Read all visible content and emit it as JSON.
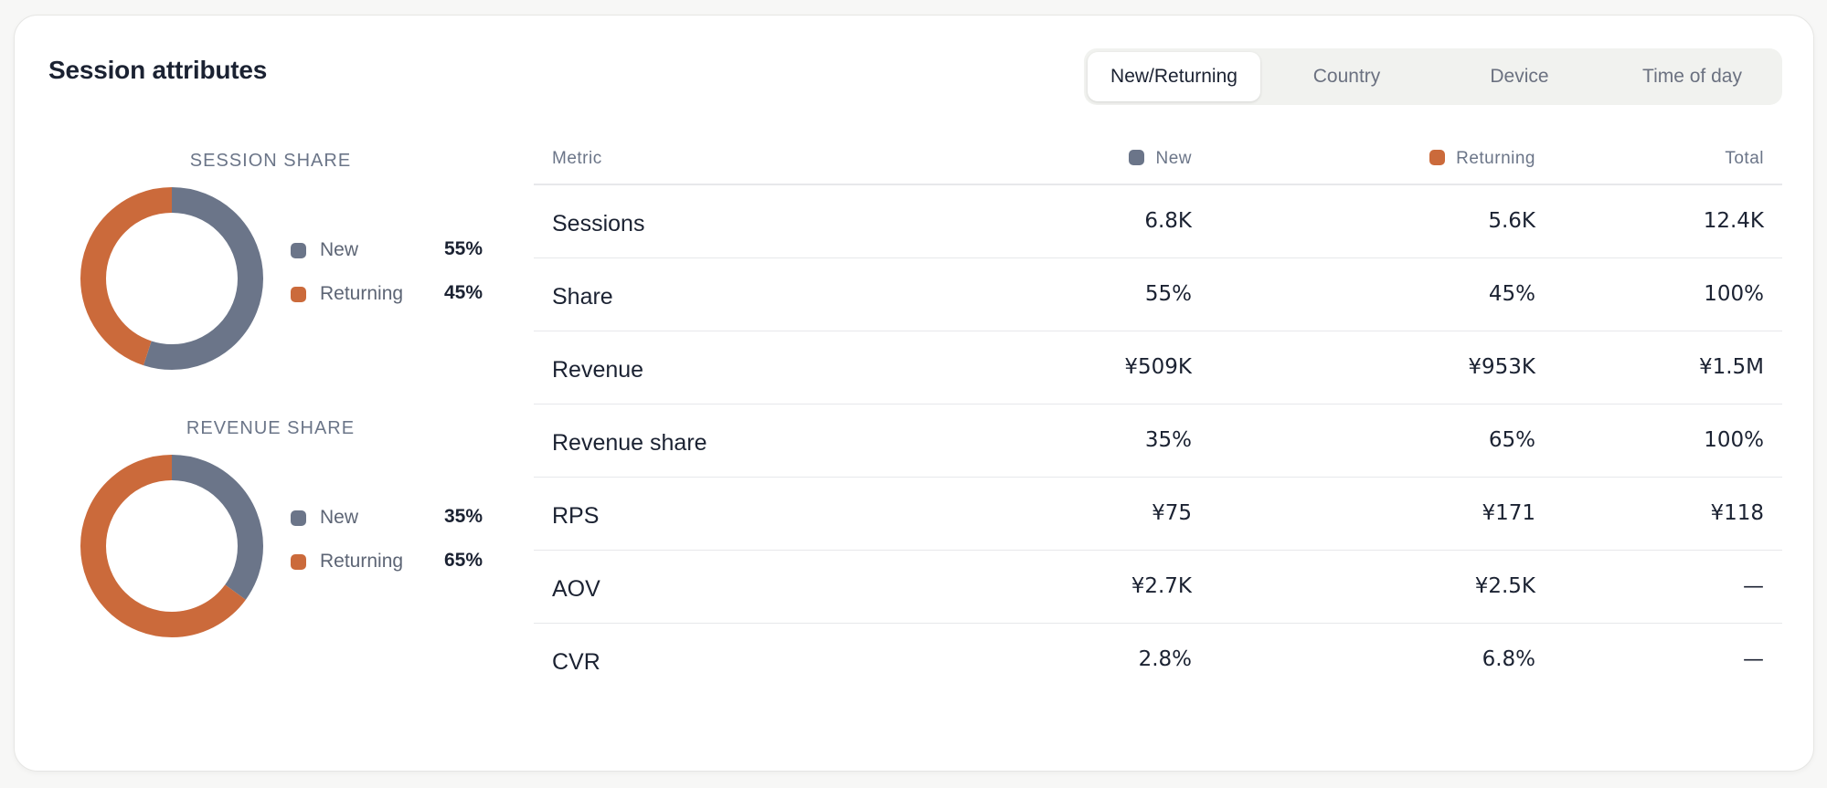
{
  "title": "Session attributes",
  "tabs": [
    {
      "label": "New/Returning",
      "active": true
    },
    {
      "label": "Country",
      "active": false
    },
    {
      "label": "Device",
      "active": false
    },
    {
      "label": "Time of day",
      "active": false
    }
  ],
  "colors": {
    "new": "#6b7589",
    "returning": "#cb6a3b"
  },
  "session_share": {
    "title": "SESSION SHARE",
    "items": [
      {
        "label": "New",
        "value": "55%",
        "fraction": 0.55
      },
      {
        "label": "Returning",
        "value": "45%",
        "fraction": 0.45
      }
    ]
  },
  "revenue_share": {
    "title": "REVENUE SHARE",
    "items": [
      {
        "label": "New",
        "value": "35%",
        "fraction": 0.35
      },
      {
        "label": "Returning",
        "value": "65%",
        "fraction": 0.65
      }
    ]
  },
  "table": {
    "headers": {
      "metric": "Metric",
      "new": "New",
      "returning": "Returning",
      "total": "Total"
    },
    "rows": [
      {
        "metric": "Sessions",
        "new": "6.8K",
        "returning": "5.6K",
        "total": "12.4K"
      },
      {
        "metric": "Share",
        "new": "55%",
        "returning": "45%",
        "total": "100%"
      },
      {
        "metric": "Revenue",
        "new": "¥509K",
        "returning": "¥953K",
        "total": "¥1.5M"
      },
      {
        "metric": "Revenue share",
        "new": "35%",
        "returning": "65%",
        "total": "100%"
      },
      {
        "metric": "RPS",
        "new": "¥75",
        "returning": "¥171",
        "total": "¥118"
      },
      {
        "metric": "AOV",
        "new": "¥2.7K",
        "returning": "¥2.5K",
        "total": "—"
      },
      {
        "metric": "CVR",
        "new": "2.8%",
        "returning": "6.8%",
        "total": "—"
      }
    ]
  }
}
